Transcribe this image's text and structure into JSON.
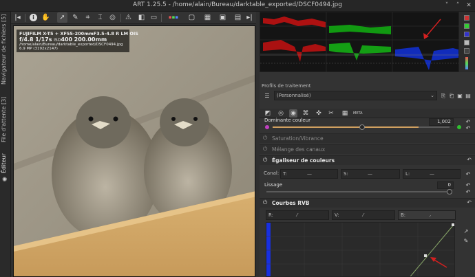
{
  "window": {
    "title": "ART 1.25.5 - /home/alain/Bureau/darktable_exported/DSCF0494.jpg",
    "buttons": [
      "˅",
      "˄",
      "✕"
    ]
  },
  "sidebar_tabs": [
    {
      "label": "Navigateur de fichiers [5]"
    },
    {
      "label": "File d'attente [3]"
    },
    {
      "label": "Éditeur"
    }
  ],
  "toolbar": {
    "icons": [
      "collapse-left-icon",
      "info-icon",
      "hand-icon",
      "pointer-icon",
      "color-picker-icon",
      "crop-icon",
      "straighten-icon",
      "spot-icon",
      "warning-icon",
      "compare-icon",
      "film-icon"
    ]
  },
  "exif": {
    "camera": "FUJIFILM X-T5 + XF55-200mmF3.5-4.8 R LM OIS",
    "aperture": "f/4.8",
    "shutter": "1/17s",
    "iso_label": "ISO",
    "iso": "400",
    "focal": "200.00mm",
    "path": "/home/alain/Bureau/darktable_exported/DSCF0494.jpg",
    "size": "6.9 MP (3192x2147)"
  },
  "histogram": {
    "colors": {
      "red": "#e01010",
      "green": "#10c010",
      "blue": "#1030e0"
    }
  },
  "profiles": {
    "label": "Profils de traitement",
    "value": "(Personnalisé)"
  },
  "modules": {
    "dominante": {
      "label": "Dominante couleur",
      "value": "1,002"
    },
    "saturation": {
      "label": "Saturation/Vibrance"
    },
    "melange": {
      "label": "Mélange des canaux"
    },
    "egaliseur": {
      "label": "Égaliseur de couleurs",
      "canal": "Canal:",
      "t": "T:",
      "s": "S:",
      "l": "L:",
      "dash": "—",
      "lissage": "Lissage",
      "lissage_value": "0"
    },
    "courbes": {
      "label": "Courbes RVB",
      "r": "R:",
      "v": "V:",
      "b": "B:"
    }
  },
  "annotation_color": "#d42020",
  "panel_tab_meta": "META"
}
